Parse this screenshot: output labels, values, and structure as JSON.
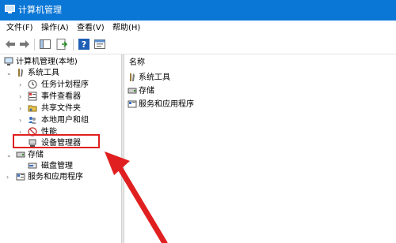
{
  "window": {
    "title": "计算机管理"
  },
  "menu": [
    "文件(F)",
    "操作(A)",
    "查看(V)",
    "帮助(H)"
  ],
  "tree": {
    "root": "计算机管理(本地)",
    "system_tools": "系统工具",
    "task_scheduler": "任务计划程序",
    "event_viewer": "事件查看器",
    "shared_folders": "共享文件夹",
    "local_users": "本地用户和组",
    "performance": "性能",
    "device_manager": "设备管理器",
    "storage": "存储",
    "disk_management": "磁盘管理",
    "services_apps": "服务和应用程序"
  },
  "right": {
    "header": "名称",
    "items": [
      "系统工具",
      "存储",
      "服务和应用程序"
    ]
  },
  "colors": {
    "titlebar": "#0a76d6",
    "highlight": "#e02020"
  }
}
